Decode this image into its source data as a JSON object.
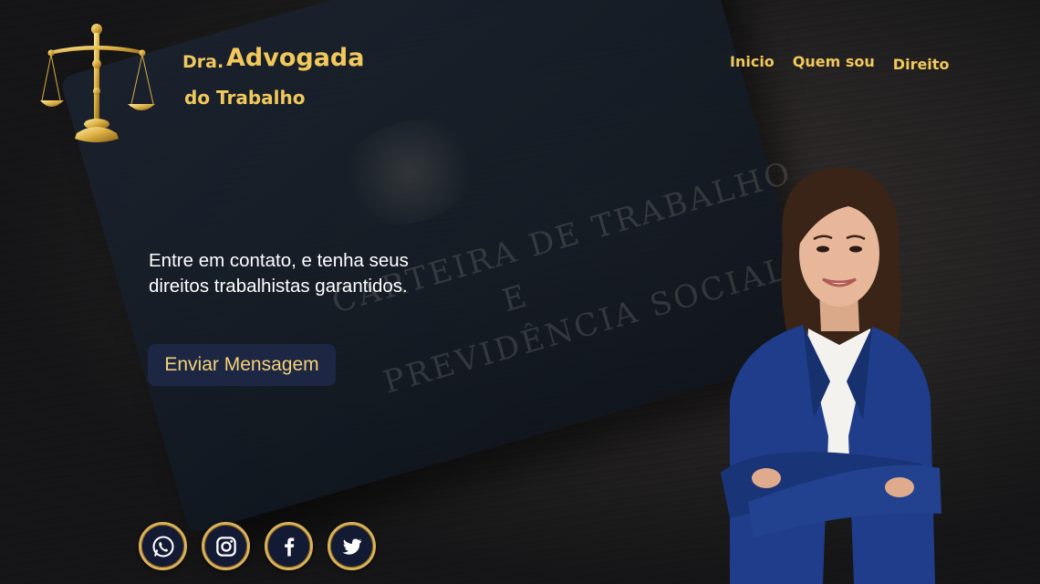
{
  "brand": {
    "prefix": "Dra.",
    "title": "Advogada",
    "subtitle": "do Trabalho",
    "logo_icon": "scales-of-justice-icon"
  },
  "nav": {
    "items": [
      {
        "label": "Inicio"
      },
      {
        "label": "Quem sou"
      },
      {
        "label": "Direito"
      }
    ]
  },
  "hero": {
    "text": "Entre em contato, e tenha seus direitos trabalhistas garantidos.",
    "button_label": "Enviar Mensagem"
  },
  "background_book": {
    "line1": "CARTEIRA DE TRABALHO",
    "line2": "E",
    "line3": "PREVIDÊNCIA SOCIAL"
  },
  "social": {
    "icons": [
      "whatsapp-icon",
      "instagram-icon",
      "facebook-icon",
      "twitter-icon"
    ]
  },
  "colors": {
    "accent_gold": "#f1c85c",
    "button_bg": "#1d2643",
    "social_bg": "#131a33"
  }
}
